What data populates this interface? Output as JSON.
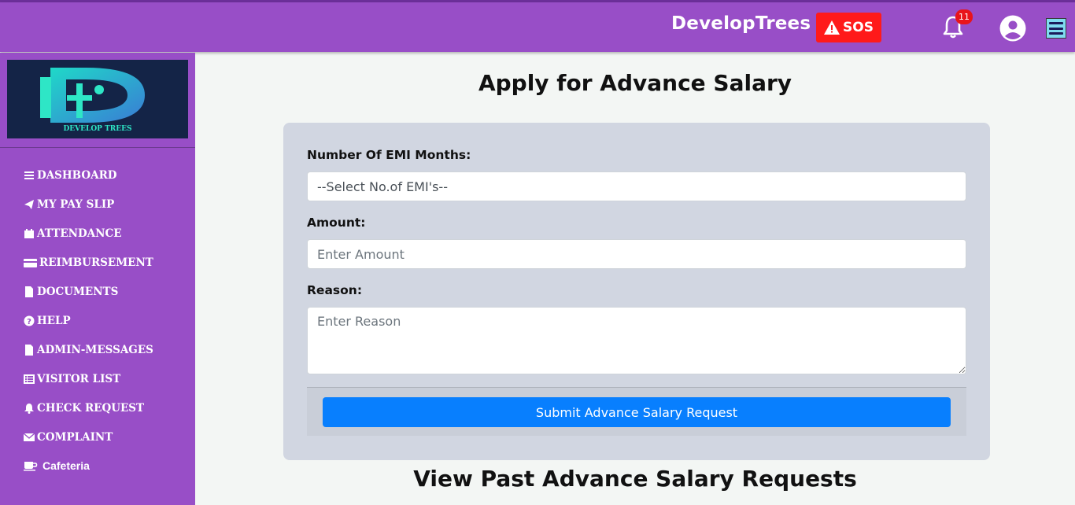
{
  "header": {
    "brand": "DevelopTrees",
    "sos_label": "SOS",
    "notification_count": "11"
  },
  "sidebar": {
    "logo_text": "DEVELOP TREES",
    "items": [
      {
        "label": "DASHBOARD",
        "icon": "bars-icon"
      },
      {
        "label": "MY PAY SLIP",
        "icon": "paper-plane-icon"
      },
      {
        "label": "ATTENDANCE",
        "icon": "calendar-icon"
      },
      {
        "label": "REIMBURSEMENT",
        "icon": "credit-card-icon"
      },
      {
        "label": "DOCUMENTS",
        "icon": "file-icon"
      },
      {
        "label": "HELP",
        "icon": "question-circle-icon"
      },
      {
        "label": "ADMIN-MESSAGES",
        "icon": "file-icon"
      },
      {
        "label": "VISITOR LIST",
        "icon": "list-icon"
      },
      {
        "label": "CHECK REQUEST",
        "icon": "bell-icon"
      },
      {
        "label": "COMPLAINT",
        "icon": "envelope-icon"
      },
      {
        "label": "Cafeteria",
        "icon": "coffee-icon"
      }
    ]
  },
  "main": {
    "title": "Apply for Advance Salary",
    "emi_label": "Number Of EMI Months:",
    "emi_selected": "--Select No.of EMI's--",
    "amount_label": "Amount:",
    "amount_placeholder": "Enter Amount",
    "reason_label": "Reason:",
    "reason_placeholder": "Enter Reason",
    "submit_label": "Submit Advance Salary Request",
    "past_title": "View Past Advance Salary Requests"
  },
  "colors": {
    "purple": "#984ec7",
    "sos_red": "#ff1a1a",
    "primary_blue": "#087ffe",
    "card_bg": "#d1d6e1"
  }
}
